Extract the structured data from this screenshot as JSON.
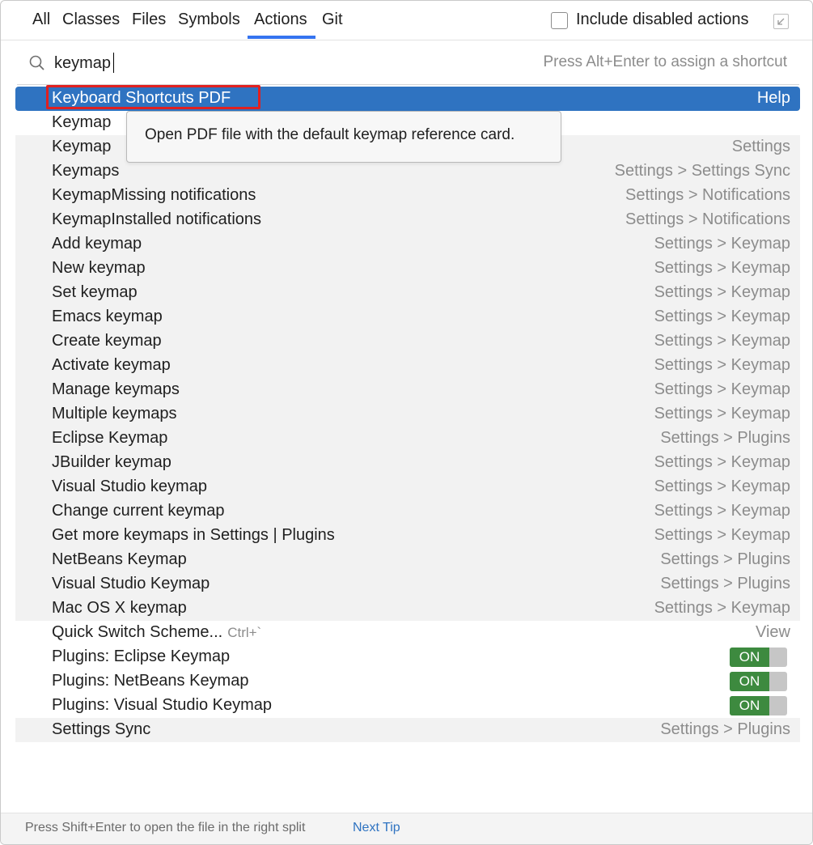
{
  "tabs": [
    {
      "label": "All"
    },
    {
      "label": "Classes"
    },
    {
      "label": "Files"
    },
    {
      "label": "Symbols"
    },
    {
      "label": "Actions"
    },
    {
      "label": "Git"
    }
  ],
  "active_tab": "Actions",
  "include_disabled": {
    "label": "Include disabled actions",
    "checked": false
  },
  "search": {
    "value": "keymap",
    "hint": "Press Alt+Enter to assign a shortcut"
  },
  "tooltip": "Open PDF file with the default keymap reference card.",
  "results": [
    {
      "name": "Keyboard Shortcuts PDF",
      "location": "Help"
    },
    {
      "name": "Keymap",
      "location": ""
    },
    {
      "name": "Keymap",
      "location": "Settings"
    },
    {
      "name": "Keymaps",
      "location": "Settings > Settings Sync"
    },
    {
      "name": "KeymapMissing notifications",
      "location": "Settings > Notifications"
    },
    {
      "name": "KeymapInstalled notifications",
      "location": "Settings > Notifications"
    },
    {
      "name": "Add keymap",
      "location": "Settings > Keymap"
    },
    {
      "name": "New keymap",
      "location": "Settings > Keymap"
    },
    {
      "name": "Set keymap",
      "location": "Settings > Keymap"
    },
    {
      "name": "Emacs keymap",
      "location": "Settings > Keymap"
    },
    {
      "name": "Create keymap",
      "location": "Settings > Keymap"
    },
    {
      "name": "Activate keymap",
      "location": "Settings > Keymap"
    },
    {
      "name": "Manage keymaps",
      "location": "Settings > Keymap"
    },
    {
      "name": "Multiple keymaps",
      "location": "Settings > Keymap"
    },
    {
      "name": "Eclipse Keymap",
      "location": "Settings > Plugins"
    },
    {
      "name": "JBuilder keymap",
      "location": "Settings > Keymap"
    },
    {
      "name": "Visual Studio keymap",
      "location": "Settings > Keymap"
    },
    {
      "name": "Change current keymap",
      "location": "Settings > Keymap"
    },
    {
      "name": "Get more keymaps in Settings | Plugins",
      "location": "Settings > Keymap"
    },
    {
      "name": "NetBeans Keymap",
      "location": "Settings > Plugins"
    },
    {
      "name": "Visual Studio Keymap",
      "location": "Settings > Plugins"
    },
    {
      "name": "Mac OS X keymap",
      "location": "Settings > Keymap"
    },
    {
      "name": "Quick Switch Scheme...",
      "shortcut": "Ctrl+`",
      "location": "View"
    },
    {
      "name": "Plugins: Eclipse Keymap",
      "toggle": "ON"
    },
    {
      "name": "Plugins: NetBeans Keymap",
      "toggle": "ON"
    },
    {
      "name": "Plugins: Visual Studio Keymap",
      "toggle": "ON"
    },
    {
      "name": "Settings Sync",
      "location": "Settings > Plugins"
    }
  ],
  "footer": {
    "hint": "Press Shift+Enter to open the file in the right split",
    "link": "Next Tip"
  },
  "colors": {
    "selection": "#2f73c1",
    "accent": "#3574f0",
    "toggle_on": "#3d8a3f",
    "highlight_box": "#e02020"
  }
}
